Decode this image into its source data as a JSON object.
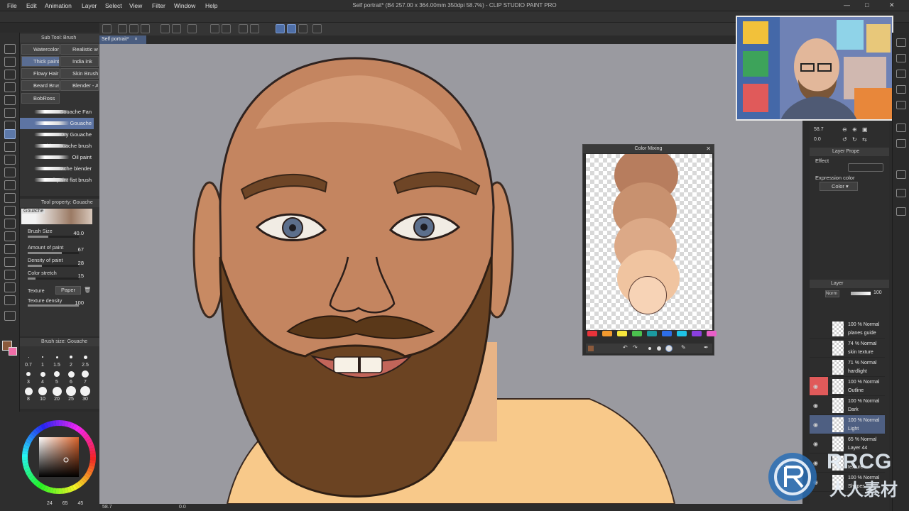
{
  "app": {
    "title": "Self portrait* (B4 257.00 x 364.00mm 350dpi 58.7%) - CLIP STUDIO PAINT PRO"
  },
  "menu": [
    "File",
    "Edit",
    "Animation",
    "Layer",
    "Select",
    "View",
    "Filter",
    "Window",
    "Help"
  ],
  "canvas": {
    "tab_label": "Self portrait*"
  },
  "subtool": {
    "header": "Sub Tool: Brush",
    "groups": [
      "Watercolor",
      "Realistic w",
      "Thick paint",
      "India ink",
      "Flowy Hair",
      "Skin Brush",
      "Beard Brus",
      "Blender - A",
      "BobRoss"
    ],
    "selected_group": "Thick paint",
    "brushes": [
      "Gouache Fan",
      "Gouache",
      "Dry Gouache",
      "Thin Gouache brush",
      "Oil paint",
      "Gouache blender",
      "Oil paint flat brush"
    ],
    "selected_brush": "Gouache"
  },
  "tool_property": {
    "header": "Tool property: Gouache",
    "preview_label": "Gouache",
    "brush_size_label": "Brush Size",
    "brush_size_value": "40.0",
    "brush_size_fraction": 0.4,
    "amount_of_paint_label": "Amount of paint",
    "amount_of_paint_value": "67",
    "amount_of_paint_fraction": 0.67,
    "density_of_paint_label": "Density of paint",
    "density_of_paint_value": "28",
    "density_of_paint_fraction": 0.28,
    "color_stretch_label": "Color stretch",
    "color_stretch_value": "15",
    "color_stretch_fraction": 0.15,
    "texture_label": "Texture",
    "texture_value": "Paper",
    "texture_density_label": "Texture density",
    "texture_density_value": "100",
    "texture_density_fraction": 1.0
  },
  "brush_size_panel": {
    "header": "Brush size: Gouache",
    "sizes": [
      "0.7",
      "1",
      "1.5",
      "2",
      "2.5",
      "3",
      "4",
      "5",
      "6",
      "7",
      "8",
      "10",
      "20",
      "25",
      "30"
    ]
  },
  "color_panel": {
    "main_color": "#8b5a3c",
    "sub_color": "#f06ea8",
    "readout": [
      "24",
      "65",
      "45"
    ]
  },
  "color_mixing": {
    "title": "Color Mixing",
    "palette": [
      "#e8333a",
      "#f39a2e",
      "#f6e63d",
      "#4bc24e",
      "#1b9aa0",
      "#2d6ee8",
      "#1fc3e6",
      "#8a3fe0",
      "#e85fc8"
    ]
  },
  "properties": {
    "header": "Layer Prope",
    "zoom_value": "58.7",
    "rotate_value": "0.0",
    "effect_label": "Effect",
    "expression_color_label": "Expression color",
    "expression_color_value": "Color"
  },
  "layers": {
    "header": "Layer",
    "blend_mode": "Norm",
    "opacity": "100",
    "items": [
      {
        "mode": "100 % Normal",
        "name": "planes guide",
        "visible": false,
        "selected": false,
        "highlight": false
      },
      {
        "mode": "74 % Normal",
        "name": "skin texture",
        "visible": false,
        "selected": false,
        "highlight": false
      },
      {
        "mode": "71 % Normal",
        "name": "hardlight",
        "visible": false,
        "selected": false,
        "highlight": false
      },
      {
        "mode": "100 % Normal",
        "name": "Outline",
        "visible": true,
        "selected": false,
        "highlight": true
      },
      {
        "mode": "100 % Normal",
        "name": "Dark",
        "visible": true,
        "selected": false,
        "highlight": false
      },
      {
        "mode": "100 % Normal",
        "name": "Light",
        "visible": true,
        "selected": true,
        "highlight": false
      },
      {
        "mode": "65 % Normal",
        "name": "Layer 44",
        "visible": true,
        "selected": false,
        "highlight": false
      },
      {
        "mode": "",
        "name": "texture",
        "visible": true,
        "selected": false,
        "highlight": false
      },
      {
        "mode": "100 % Normal",
        "name": "Shapes",
        "visible": true,
        "selected": false,
        "highlight": false
      }
    ]
  },
  "statusbar": {
    "zoom": "58.7",
    "rotation": "0.0"
  },
  "watermark": {
    "brand": "RRCG",
    "tagline": "人人素材"
  }
}
